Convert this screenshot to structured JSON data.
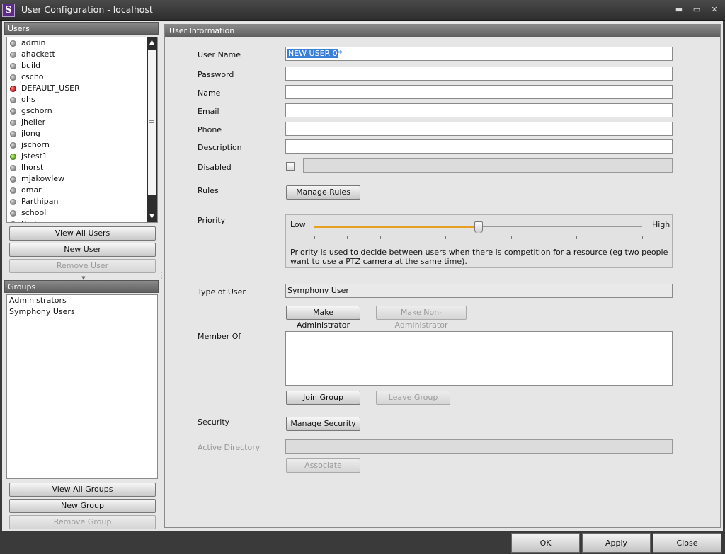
{
  "window": {
    "title": "User Configuration - localhost",
    "logo_letter": "S",
    "controls": {
      "minimize": "▬",
      "maximize": "▭",
      "close": "✕"
    }
  },
  "users_panel": {
    "header": "Users",
    "items": [
      {
        "name": "admin",
        "status": "gray"
      },
      {
        "name": "ahackett",
        "status": "gray"
      },
      {
        "name": "build",
        "status": "gray"
      },
      {
        "name": "cscho",
        "status": "gray"
      },
      {
        "name": "DEFAULT_USER",
        "status": "red"
      },
      {
        "name": "dhs",
        "status": "gray"
      },
      {
        "name": "gschorn",
        "status": "gray"
      },
      {
        "name": "jheller",
        "status": "gray"
      },
      {
        "name": "jlong",
        "status": "gray"
      },
      {
        "name": "jschorn",
        "status": "gray"
      },
      {
        "name": "jstest1",
        "status": "green"
      },
      {
        "name": "lhorst",
        "status": "gray"
      },
      {
        "name": "mjakowlew",
        "status": "gray"
      },
      {
        "name": "omar",
        "status": "gray"
      },
      {
        "name": "Parthipan",
        "status": "gray"
      },
      {
        "name": "school",
        "status": "gray"
      },
      {
        "name": "thef",
        "status": "gray"
      }
    ],
    "buttons": {
      "view_all": "View All Users",
      "new": "New User",
      "remove": "Remove User"
    }
  },
  "groups_panel": {
    "header": "Groups",
    "items": [
      "Administrators",
      "Symphony Users"
    ],
    "buttons": {
      "view_all": "View All Groups",
      "new": "New Group",
      "remove": "Remove Group"
    }
  },
  "user_info": {
    "header": "User Information",
    "labels": {
      "user_name": "User Name",
      "password": "Password",
      "name": "Name",
      "email": "Email",
      "phone": "Phone",
      "description": "Description",
      "disabled": "Disabled",
      "rules": "Rules",
      "priority": "Priority",
      "type_of_user": "Type of User",
      "member_of": "Member Of",
      "security": "Security",
      "active_directory": "Active Directory"
    },
    "values": {
      "user_name": "NEW USER 0",
      "user_name_suffix": "*",
      "password": "",
      "name": "",
      "email": "",
      "phone": "",
      "description": "",
      "disabled_checked": false,
      "type_of_user": "Symphony User",
      "active_directory": ""
    },
    "buttons": {
      "manage_rules": "Manage Rules",
      "make_admin": "Make Administrator",
      "make_non_admin": "Make Non-Administrator",
      "join_group": "Join Group",
      "leave_group": "Leave Group",
      "manage_security": "Manage Security",
      "associate": "Associate"
    },
    "priority": {
      "low_label": "Low",
      "high_label": "High",
      "value_fraction": 0.5,
      "description": "Priority is used to decide between users when there is competition for a resource  (eg two people want to use a PTZ camera at the same time)."
    }
  },
  "footer": {
    "ok": "OK",
    "apply": "Apply",
    "close": "Close"
  },
  "colors": {
    "accent": "#e8a020",
    "selection": "#3b7fd6",
    "panel_header": "#6f6f6f"
  }
}
